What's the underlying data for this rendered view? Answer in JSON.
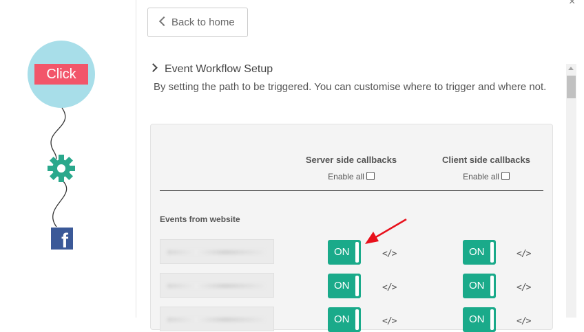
{
  "illustration": {
    "click_label": "Click",
    "gear_icon": "gear-icon",
    "facebook_icon": "facebook-icon",
    "facebook_glyph": "f",
    "bubble_color": "#a8dee9",
    "accent_red": "#f2566a",
    "gear_color": "#2aa88c",
    "facebook_color": "#3b5998"
  },
  "header": {
    "back_label": "Back to home",
    "close_glyph": "×"
  },
  "section": {
    "title": "Event Workflow Setup",
    "description": "By setting the path to be triggered. You can customise where to trigger and where not."
  },
  "table": {
    "columns": [
      {
        "title": "Server side callbacks",
        "enable_all_label": "Enable all",
        "enable_all_checked": false
      },
      {
        "title": "Client side callbacks",
        "enable_all_label": "Enable all",
        "enable_all_checked": false
      }
    ],
    "events_label": "Events from website",
    "rows": [
      {
        "server_toggle": "ON",
        "client_toggle": "ON",
        "code_icon": "</>"
      },
      {
        "server_toggle": "ON",
        "client_toggle": "ON",
        "code_icon": "</>"
      },
      {
        "server_toggle": "ON",
        "client_toggle": "ON",
        "code_icon": "</>"
      }
    ],
    "toggle_color": "#1aaa8a"
  },
  "annotation": {
    "arrow_color": "#e8101b"
  }
}
